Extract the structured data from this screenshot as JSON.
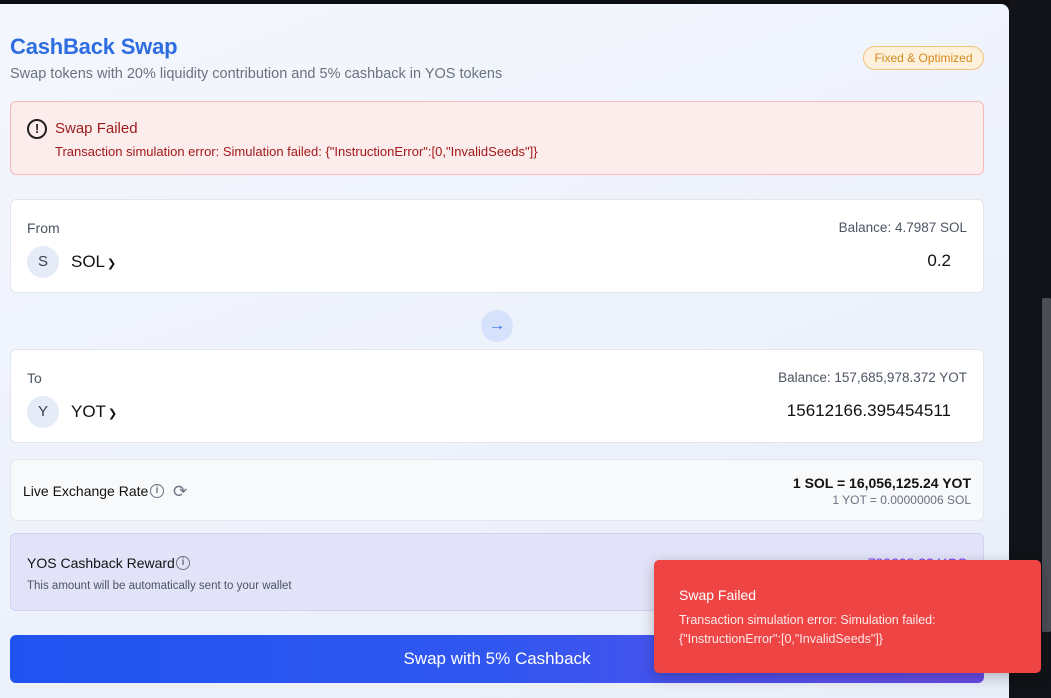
{
  "header": {
    "title": "CashBack Swap",
    "subtitle": "Swap tokens with 20% liquidity contribution and 5% cashback in YOS tokens",
    "badge": "Fixed & Optimized"
  },
  "alert": {
    "icon": "alert-circle-icon",
    "title": "Swap Failed",
    "message": "Transaction simulation error: Simulation failed: {\"InstructionError\":[0,\"InvalidSeeds\"]}"
  },
  "from": {
    "label": "From",
    "balance": "Balance: 4.7987 SOL",
    "token_initial": "S",
    "token": "SOL",
    "amount": "0.2"
  },
  "swap_direction_icon": "arrow-right-icon",
  "to": {
    "label": "To",
    "balance": "Balance: 157,685,978.372 YOT",
    "token_initial": "Y",
    "token": "YOT",
    "amount": "15612166.395454511"
  },
  "rate": {
    "label": "Live Exchange Rate",
    "main": "1 SOL = 16,056,125.24 YOT",
    "sub": "1 YOT = 0.00000006 SOL"
  },
  "cashback": {
    "title": "YOS Cashback Reward",
    "subtitle": "This amount will be automatically sent to your wallet",
    "amount": "780608.32 YOS"
  },
  "swap_button": "Swap with 5% Cashback",
  "toast": {
    "title": "Swap Failed",
    "message": "Transaction simulation error: Simulation failed: {\"InstructionError\":[0,\"InvalidSeeds\"]}"
  },
  "colors": {
    "accent": "#2e6de0",
    "error": "#ef4444",
    "badge": "#d4891b"
  }
}
